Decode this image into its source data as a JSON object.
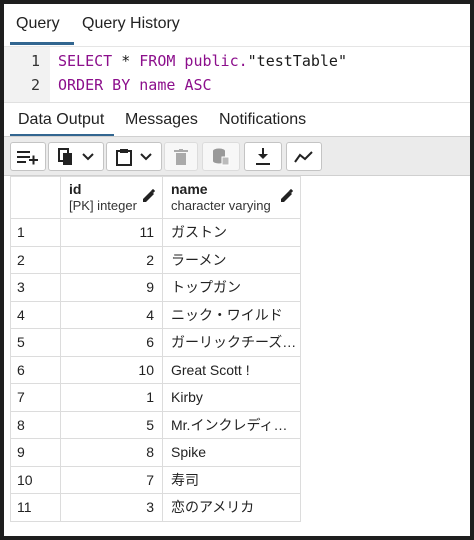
{
  "query_tabs": [
    {
      "label": "Query"
    },
    {
      "label": "Query History"
    }
  ],
  "editor": {
    "line_numbers": [
      "1",
      "2"
    ],
    "line1": {
      "kw1": "SELECT",
      "star": " * ",
      "kw2": "FROM",
      "ident": " public.",
      "str": "\"testTable\""
    },
    "line2": {
      "kw1": "ORDER BY",
      "ident": " name ",
      "kw2": "ASC"
    }
  },
  "output_tabs": [
    {
      "label": "Data Output"
    },
    {
      "label": "Messages"
    },
    {
      "label": "Notifications"
    }
  ],
  "toolbar": {
    "icons": [
      "add-row-icon",
      "copy-icon",
      "dropdown-icon",
      "paste-icon",
      "dropdown-icon",
      "delete-icon",
      "save-data-icon",
      "download-icon",
      "graph-icon"
    ]
  },
  "columns": [
    {
      "name": "id",
      "type": "[PK] integer"
    },
    {
      "name": "name",
      "type": "character varying"
    }
  ],
  "rows": [
    {
      "num": "1",
      "id": "11",
      "name": "ガストン"
    },
    {
      "num": "2",
      "id": "2",
      "name": "ラーメン"
    },
    {
      "num": "3",
      "id": "9",
      "name": "トップガン"
    },
    {
      "num": "4",
      "id": "4",
      "name": "ニック・ワイルド"
    },
    {
      "num": "5",
      "id": "6",
      "name": "ガーリックチーズ…"
    },
    {
      "num": "6",
      "id": "10",
      "name": "Great Scott !"
    },
    {
      "num": "7",
      "id": "1",
      "name": "Kirby"
    },
    {
      "num": "8",
      "id": "5",
      "name": "Mr.インクレディ…"
    },
    {
      "num": "9",
      "id": "8",
      "name": "Spike"
    },
    {
      "num": "10",
      "id": "7",
      "name": "寿司"
    },
    {
      "num": "11",
      "id": "3",
      "name": "恋のアメリカ"
    }
  ],
  "colors": {
    "accent": "#326690",
    "keyword": "#8c0f8c"
  }
}
